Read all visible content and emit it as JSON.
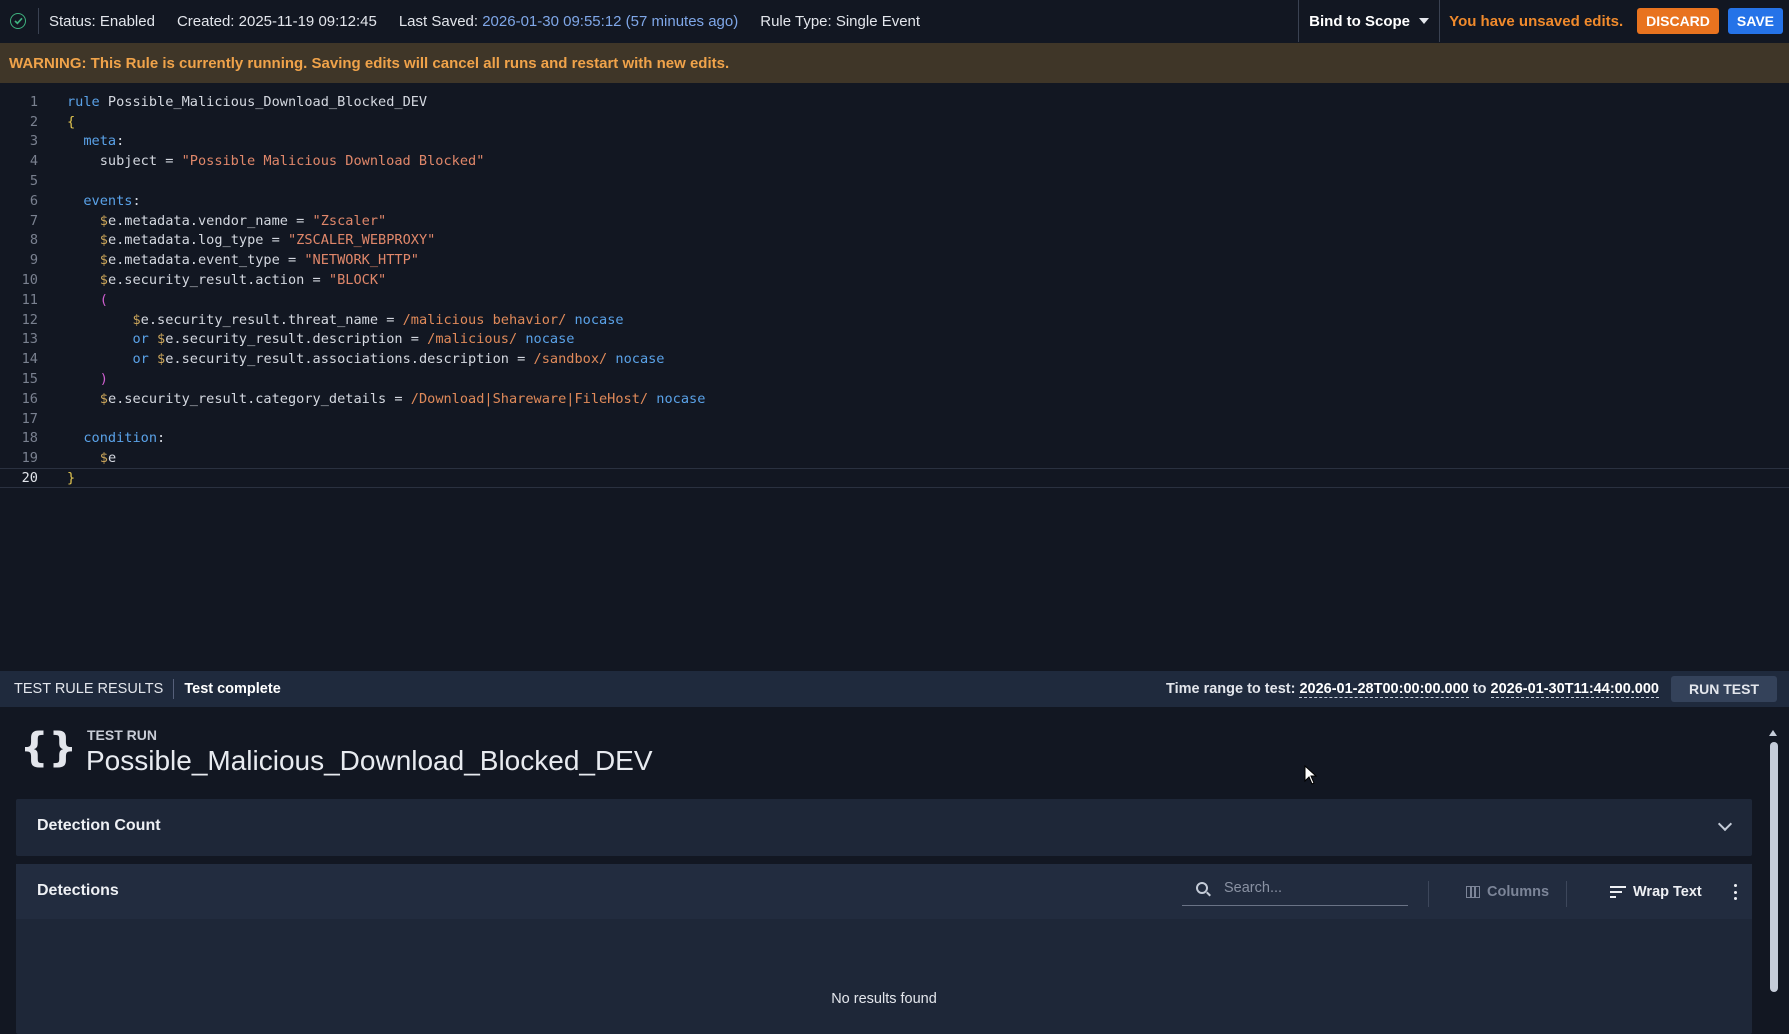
{
  "topbar": {
    "status_label": "Status:",
    "status_value": "Enabled",
    "created_label": "Created:",
    "created_value": "2025-11-19 09:12:45",
    "saved_label": "Last Saved:",
    "saved_value": "2026-01-30 09:55:12 (57 minutes ago)",
    "rule_type_label": "Rule Type:",
    "rule_type_value": "Single Event",
    "bind_scope": "Bind to Scope",
    "unsaved": "You have unsaved edits.",
    "discard": "DISCARD",
    "save": "SAVE"
  },
  "warning": "WARNING: This Rule is currently running. Saving edits will cancel all runs and restart with new edits.",
  "editor": {
    "line_numbers": [
      "1",
      "2",
      "3",
      "4",
      "5",
      "6",
      "7",
      "8",
      "9",
      "10",
      "11",
      "12",
      "13",
      "14",
      "15",
      "16",
      "17",
      "18",
      "19",
      "20"
    ],
    "active_line": 20
  },
  "results_bar": {
    "label": "TEST RULE RESULTS",
    "state": "Test complete",
    "time_range_label": "Time range to test:",
    "time_start": "2026-01-28T00:00:00.000",
    "time_to": "to",
    "time_end": "2026-01-30T11:44:00.000",
    "run_test": "RUN TEST"
  },
  "test_run": {
    "kicker": "TEST RUN",
    "title": "Possible_Malicious_Download_Blocked_DEV",
    "detection_count_title": "Detection Count",
    "detections_title": "Detections",
    "search_placeholder": "Search...",
    "columns": "Columns",
    "wrap_text": "Wrap Text",
    "no_results": "No results found"
  },
  "colors": {
    "accent_blue": "#2573e8",
    "warning_orange": "#e8731f",
    "status_green": "#3fb27f"
  }
}
